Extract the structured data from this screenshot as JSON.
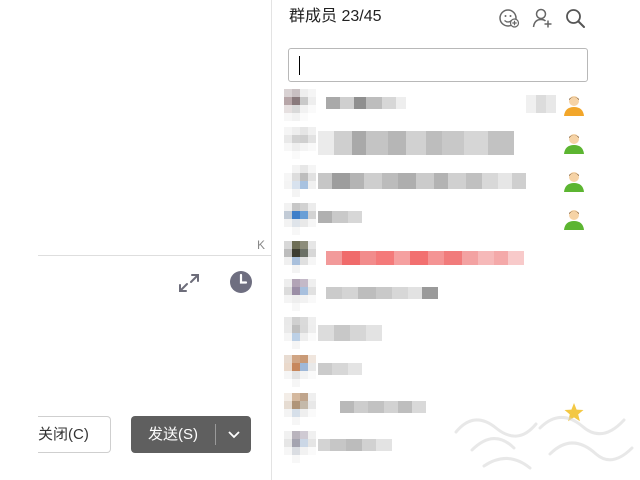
{
  "chat": {
    "collapse_glyph": "K",
    "expand_icon": "expand-icon",
    "history_icon": "clock-icon",
    "close_button_label": "关闭(C)",
    "send_button_label": "发送(S)",
    "send_dropdown_icon": "chevron-down-icon"
  },
  "members_panel": {
    "title": "群成员 23/45",
    "header_icons": [
      "add-guest-icon",
      "invite-member-icon",
      "search-icon"
    ],
    "search": {
      "value": "",
      "placeholder": ""
    },
    "members": [
      {
        "name": "",
        "role": "owner",
        "role_icon": "user-orange-icon"
      },
      {
        "name": "",
        "role": "admin",
        "role_icon": "user-green-icon"
      },
      {
        "name": "",
        "role": "admin",
        "role_icon": "user-green-icon"
      },
      {
        "name": "",
        "role": "admin",
        "role_icon": "user-green-icon"
      },
      {
        "name": "",
        "role": "member",
        "role_icon": ""
      },
      {
        "name": "",
        "role": "member",
        "role_icon": ""
      },
      {
        "name": "",
        "role": "member",
        "role_icon": ""
      },
      {
        "name": "",
        "role": "member",
        "role_icon": ""
      },
      {
        "name": "",
        "role": "member",
        "role_icon": "star-icon"
      },
      {
        "name": "",
        "role": "member",
        "role_icon": ""
      }
    ]
  },
  "colors": {
    "send_button_bg": "#5f5f5f",
    "admin_icon_green": "#5cb531",
    "owner_icon_orange": "#f2a62a",
    "highlight_name_red": "#f47a7a"
  }
}
